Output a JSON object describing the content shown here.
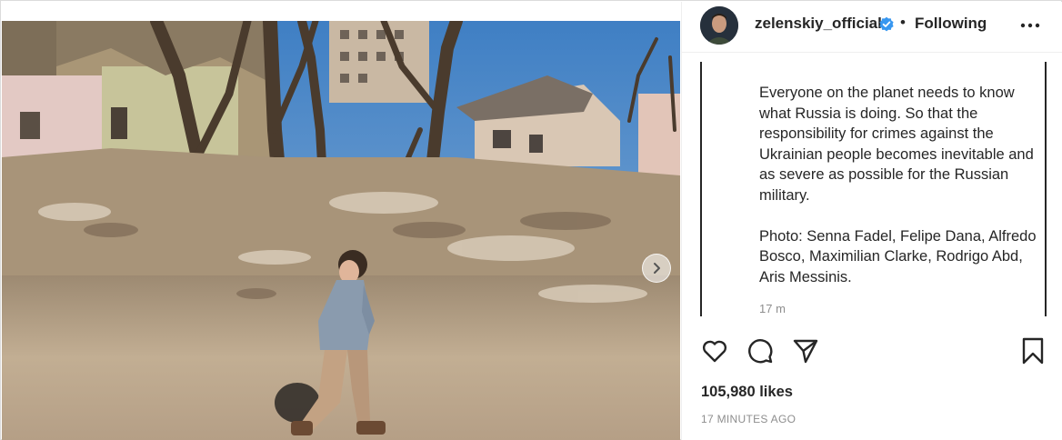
{
  "post": {
    "photo_alt": "photo",
    "carousel_next_icon": "chevron-right-icon"
  },
  "header": {
    "username": "zelenskiy_official",
    "verified_icon": "verified-badge-icon",
    "separator": "•",
    "follow_status": "Following",
    "more_icon": "more-options-icon"
  },
  "caption": {
    "text": "Everyone on the planet needs to know what Russia is doing. So that the responsibility for crimes against the Ukrainian people becomes inevitable and as severe as possible for the Russian military.\n\nPhoto: Senna Fadel, Felipe Dana, Alfredo Bosco, Maximilian Clarke, Rodrigo Abd, Aris Messinis.",
    "time": "17 m"
  },
  "actions": {
    "like_icon": "heart-icon",
    "comment_icon": "comment-icon",
    "share_icon": "share-icon",
    "save_icon": "bookmark-icon"
  },
  "likes": "105,980 likes",
  "timestamp": "17 MINUTES AGO",
  "colors": {
    "text": "#262626",
    "muted": "#8e8e8e",
    "verified": "#3897f0",
    "border": "#dbdbdb"
  }
}
